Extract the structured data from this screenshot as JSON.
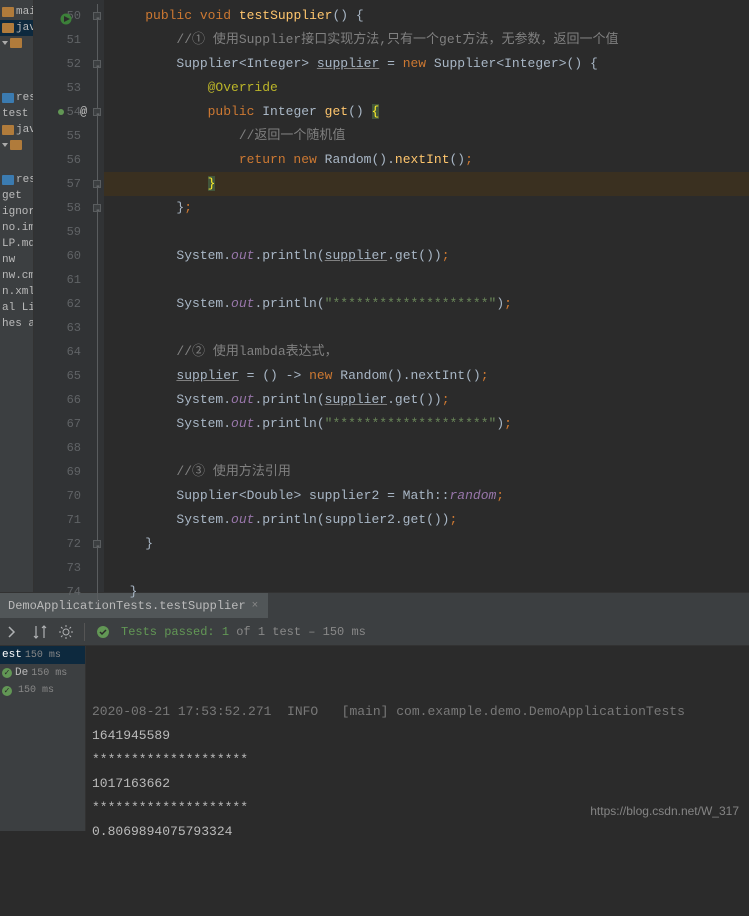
{
  "gutter_start": 50,
  "gutter_count": 25,
  "project_tree": [
    {
      "type": "row",
      "label": "main",
      "icon": "folder"
    },
    {
      "type": "row",
      "label": "jav",
      "icon": "folder",
      "cls": "sel"
    },
    {
      "type": "row",
      "label": "",
      "icon": "arrow"
    },
    {
      "type": "spacer"
    },
    {
      "type": "spacer"
    },
    {
      "type": "row",
      "label": "res",
      "icon": "folder",
      "folderCls": "res"
    },
    {
      "type": "row",
      "label": "test"
    },
    {
      "type": "row",
      "label": "jav",
      "icon": "folder"
    },
    {
      "type": "row",
      "label": "",
      "icon": "arrow"
    },
    {
      "type": "spacer"
    },
    {
      "type": "row",
      "label": "res",
      "icon": "folder",
      "folderCls": "res"
    },
    {
      "type": "row",
      "label": "get"
    },
    {
      "type": "row",
      "label": "ignore"
    },
    {
      "type": "row",
      "label": "no.iml"
    },
    {
      "type": "row",
      "label": "LP.md"
    },
    {
      "type": "row",
      "label": "nw"
    },
    {
      "type": "row",
      "label": "nw.cm"
    },
    {
      "type": "row",
      "label": "n.xml"
    },
    {
      "type": "row",
      "label": "al Libr"
    },
    {
      "type": "row",
      "label": "hes ar"
    }
  ],
  "code": {
    "lines": [
      [
        [
          "pl",
          "    "
        ],
        [
          "kw",
          "public void"
        ],
        [
          "pl",
          " "
        ],
        [
          "fn",
          "testSupplier"
        ],
        [
          "br",
          "()"
        ],
        [
          "pl",
          " "
        ],
        [
          "br",
          "{"
        ]
      ],
      [
        [
          "pl",
          "        "
        ],
        [
          "cm",
          "//① 使用Supplier接口实现方法,只有一个get方法，无参数，返回一个值"
        ]
      ],
      [
        [
          "pl",
          "        "
        ],
        [
          "ty",
          "Supplier<Integer> "
        ],
        [
          "ul",
          "supplier"
        ],
        [
          "pl",
          " = "
        ],
        [
          "kw",
          "new"
        ],
        [
          "pl",
          " "
        ],
        [
          "ty",
          "Supplier<Integer>"
        ],
        [
          "br",
          "()"
        ],
        [
          "pl",
          " "
        ],
        [
          "br",
          "{"
        ]
      ],
      [
        [
          "pl",
          "            "
        ],
        [
          "ann",
          "@Override"
        ]
      ],
      [
        [
          "pl",
          "            "
        ],
        [
          "kw",
          "public"
        ],
        [
          "pl",
          " "
        ],
        [
          "ty",
          "Integer "
        ],
        [
          "fn",
          "get"
        ],
        [
          "br",
          "()"
        ],
        [
          "pl",
          " "
        ],
        [
          "caret-br",
          "{"
        ]
      ],
      [
        [
          "pl",
          "                "
        ],
        [
          "cm",
          "//返回一个随机值"
        ]
      ],
      [
        [
          "pl",
          "                "
        ],
        [
          "kw",
          "return new"
        ],
        [
          "pl",
          " "
        ],
        [
          "ty",
          "Random"
        ],
        [
          "br",
          "()"
        ],
        [
          "pl",
          "."
        ],
        [
          "fn",
          "nextInt"
        ],
        [
          "br",
          "()"
        ],
        [
          "kw",
          ";"
        ]
      ],
      [
        [
          "pl",
          "            "
        ],
        [
          "caret-br",
          "}"
        ]
      ],
      [
        [
          "pl",
          "        "
        ],
        [
          "br",
          "}"
        ],
        [
          "kw",
          ";"
        ]
      ],
      [],
      [
        [
          "pl",
          "        "
        ],
        [
          "ty",
          "System"
        ],
        [
          "pl",
          "."
        ],
        [
          "fld",
          "out"
        ],
        [
          "pl",
          ".println("
        ],
        [
          "ul",
          "supplier"
        ],
        [
          "pl",
          ".get())"
        ],
        [
          "kw",
          ";"
        ]
      ],
      [],
      [
        [
          "pl",
          "        "
        ],
        [
          "ty",
          "System"
        ],
        [
          "pl",
          "."
        ],
        [
          "fld",
          "out"
        ],
        [
          "pl",
          ".println("
        ],
        [
          "str",
          "\"********************\""
        ],
        [
          "pl",
          ")"
        ],
        [
          "kw",
          ";"
        ]
      ],
      [],
      [
        [
          "pl",
          "        "
        ],
        [
          "cm",
          "//② 使用lambda表达式，"
        ]
      ],
      [
        [
          "pl",
          "        "
        ],
        [
          "ul",
          "supplier"
        ],
        [
          "pl",
          " = () -> "
        ],
        [
          "kw",
          "new"
        ],
        [
          "pl",
          " "
        ],
        [
          "ty",
          "Random"
        ],
        [
          "pl",
          "().nextInt()"
        ],
        [
          "kw",
          ";"
        ]
      ],
      [
        [
          "pl",
          "        "
        ],
        [
          "ty",
          "System"
        ],
        [
          "pl",
          "."
        ],
        [
          "fld",
          "out"
        ],
        [
          "pl",
          ".println("
        ],
        [
          "ul",
          "supplier"
        ],
        [
          "pl",
          ".get())"
        ],
        [
          "kw",
          ";"
        ]
      ],
      [
        [
          "pl",
          "        "
        ],
        [
          "ty",
          "System"
        ],
        [
          "pl",
          "."
        ],
        [
          "fld",
          "out"
        ],
        [
          "pl",
          ".println("
        ],
        [
          "str",
          "\"********************\""
        ],
        [
          "pl",
          ")"
        ],
        [
          "kw",
          ";"
        ]
      ],
      [],
      [
        [
          "pl",
          "        "
        ],
        [
          "cm",
          "//③ 使用方法引用"
        ]
      ],
      [
        [
          "pl",
          "        "
        ],
        [
          "ty",
          "Supplier<Double>"
        ],
        [
          "pl",
          " supplier2 = Math::"
        ],
        [
          "mb",
          "random"
        ],
        [
          "kw",
          ";"
        ]
      ],
      [
        [
          "pl",
          "        "
        ],
        [
          "ty",
          "System"
        ],
        [
          "pl",
          "."
        ],
        [
          "fld",
          "out"
        ],
        [
          "pl",
          ".println(supplier2.get())"
        ],
        [
          "kw",
          ";"
        ]
      ],
      [
        [
          "pl",
          "    "
        ],
        [
          "br",
          "}"
        ]
      ],
      [],
      [
        [
          "pl",
          "  "
        ],
        [
          "br",
          "}"
        ]
      ]
    ],
    "highlight_index": 7
  },
  "bottom_tab": {
    "label": "DemoApplicationTests.testSupplier"
  },
  "test_toolbar": {
    "passed_label": "Tests passed: 1",
    "of_label": " of 1 test – 150 ms"
  },
  "results_tree": [
    {
      "label": "est",
      "time": "150 ms",
      "sel": true,
      "pass": false
    },
    {
      "label": "De",
      "time": "150 ms",
      "sel": false,
      "pass": true
    },
    {
      "label": "",
      "time": "150 ms",
      "sel": false,
      "pass": true
    }
  ],
  "console_lines": [
    {
      "cls": "dimlog",
      "text": "2020-08-21 17:53:52.271  INFO   [main] com.example.demo.DemoApplicationTests"
    },
    {
      "cls": "",
      "text": ""
    },
    {
      "cls": "logline",
      "text": "1641945589"
    },
    {
      "cls": "logline",
      "text": "********************"
    },
    {
      "cls": "logline",
      "text": "1017163662"
    },
    {
      "cls": "logline",
      "text": "********************"
    },
    {
      "cls": "logline",
      "text": "0.8069894075793324"
    }
  ],
  "watermark": "https://blog.csdn.net/W_317"
}
